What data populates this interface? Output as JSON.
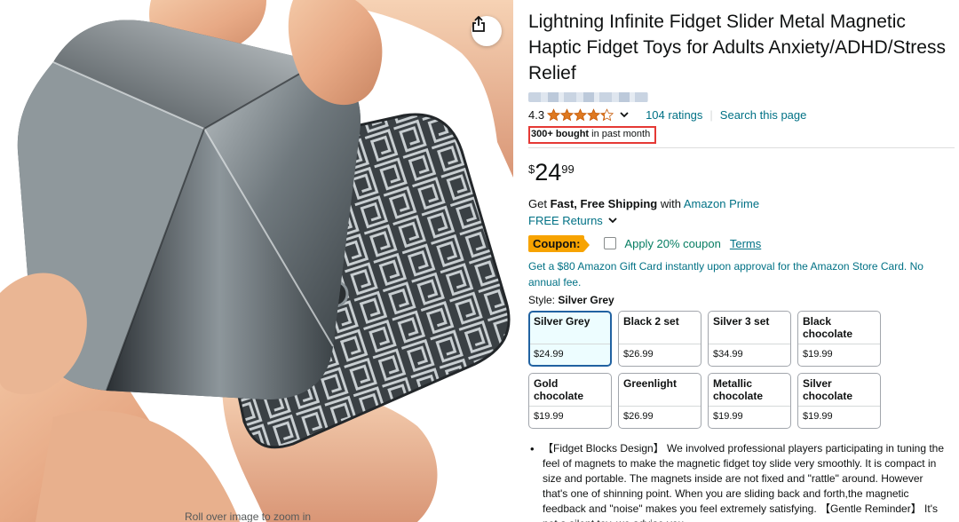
{
  "product": {
    "title": "Lightning Infinite Fidget Slider Metal Magnetic Haptic Fidget Toys for Adults Anxiety/ADHD/Stress Relief",
    "rating_value": "4.3",
    "rating_stars": 4.3,
    "ratings_link": "104 ratings",
    "search_link": "Search this page",
    "bought_bold": "300+ bought",
    "bought_rest": " in past month",
    "price_symbol": "$",
    "price_whole": "24",
    "price_fraction": "99"
  },
  "shipping": {
    "prefix": "Get ",
    "bold": "Fast, Free Shipping",
    "middle": " with ",
    "link": "Amazon Prime",
    "returns": "FREE Returns"
  },
  "coupon": {
    "badge": "Coupon:",
    "text": "Apply 20% coupon",
    "terms": "Terms"
  },
  "gift_card": "Get a $80 Amazon Gift Card instantly upon approval for the Amazon Store Card. No annual fee.",
  "style": {
    "label": "Style: ",
    "selected": "Silver Grey"
  },
  "swatches": [
    {
      "name": "Silver Grey",
      "price": "$24.99",
      "selected": true
    },
    {
      "name": "Black 2 set",
      "price": "$26.99",
      "selected": false
    },
    {
      "name": "Silver 3 set",
      "price": "$34.99",
      "selected": false
    },
    {
      "name": "Black chocolate",
      "price": "$19.99",
      "selected": false
    },
    {
      "name": "Gold chocolate",
      "price": "$19.99",
      "selected": false
    },
    {
      "name": "Greenlight",
      "price": "$26.99",
      "selected": false
    },
    {
      "name": "Metallic chocolate",
      "price": "$19.99",
      "selected": false
    },
    {
      "name": "Silver chocolate",
      "price": "$19.99",
      "selected": false
    }
  ],
  "bullets": [
    "【Fidget Blocks Design】 We involved professional players participating in tuning the feel of magnets to make the magnetic fidget toy slide very smoothly. It is compact in size and portable. The magnets inside are not fixed and \"rattle\" around. However that's one of shinning point. When you are sliding back and forth,the magnetic feedback and \"noise\" makes you feel extremely satisfying. 【Gentle Reminder】 It's not a silent toy, we advise you"
  ],
  "image": {
    "caption": "Roll over image to zoom in"
  },
  "icons": {
    "share": "share-icon",
    "star": "star-icon",
    "chevron": "chevron-down-icon"
  },
  "colors": {
    "link": "#007185",
    "star": "#de7921",
    "coupon": "#f7a300",
    "coupon_text": "#067d62",
    "highlight_box": "#e53935",
    "selected_border": "#2162a1"
  }
}
